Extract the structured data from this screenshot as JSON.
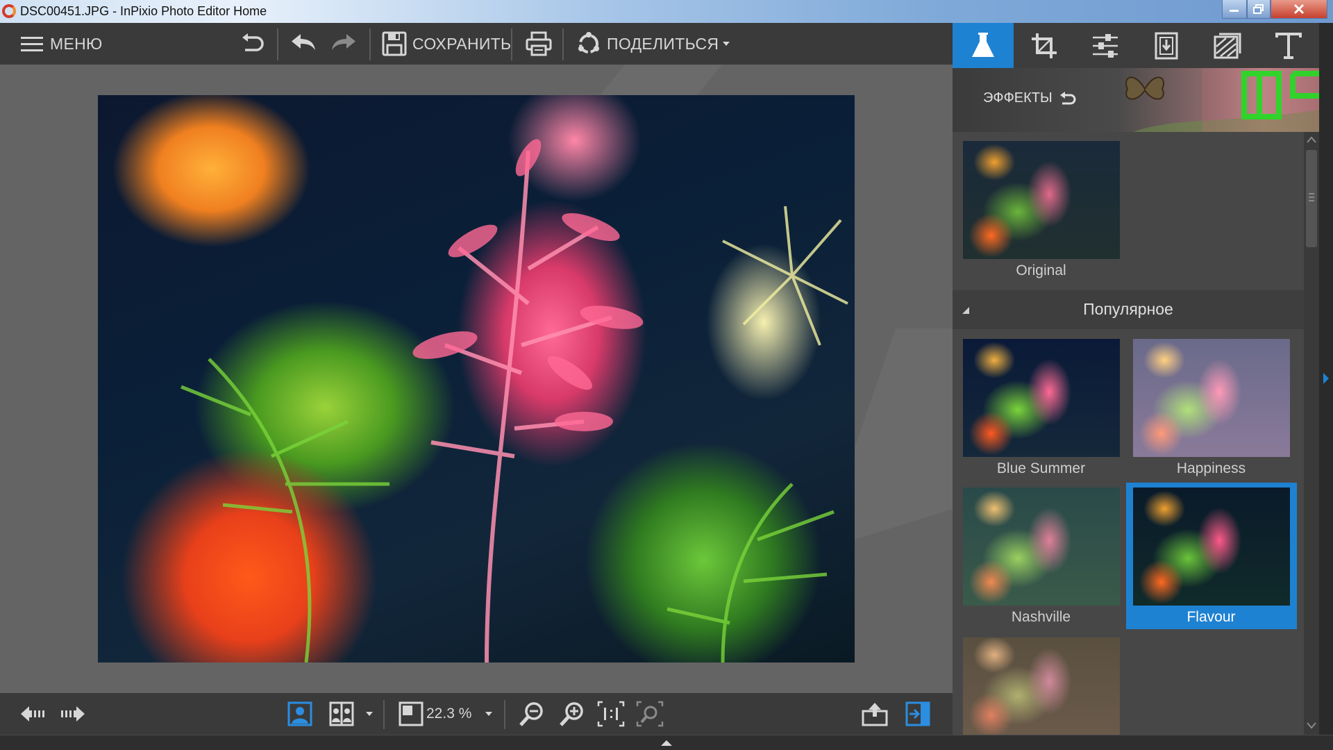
{
  "window": {
    "title": "DSC00451.JPG - InPixio Photo Editor Home",
    "controls": {
      "minimize": "minimize",
      "maximize": "maximize",
      "close": "close"
    }
  },
  "toolbar": {
    "menu_label": "МЕНЮ",
    "save_label": "СОХРАНИТЬ",
    "share_label": "ПОДЕЛИТЬСЯ",
    "icons": [
      "menu-icon",
      "reset-icon",
      "undo-icon",
      "redo-icon",
      "save-icon",
      "print-icon",
      "share-icon"
    ]
  },
  "right_panel": {
    "tabs": [
      "effects",
      "crop",
      "adjust",
      "frames",
      "textures",
      "text"
    ],
    "active_tab": "effects",
    "header_label": "ЭФФЕКТЫ",
    "section_title": "Популярное",
    "original_label": "Original",
    "effects": [
      {
        "label": "Blue Summer",
        "selected": false
      },
      {
        "label": "Happiness",
        "selected": false
      },
      {
        "label": "Nashville",
        "selected": false
      },
      {
        "label": "Flavour",
        "selected": true
      }
    ]
  },
  "bottombar": {
    "zoom_value": "22.3 %"
  },
  "colors": {
    "accent": "#1e82d2",
    "toolbar_bg": "#3a3a3a",
    "canvas_bg": "#646464",
    "panel_bg": "#474747"
  }
}
